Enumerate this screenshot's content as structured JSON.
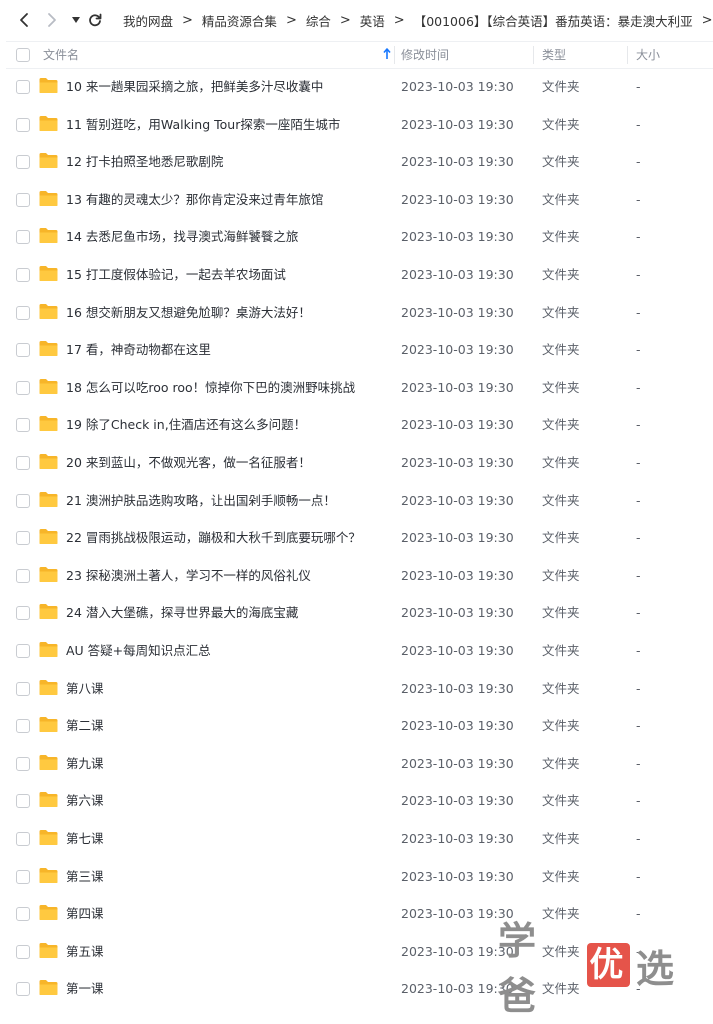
{
  "nav": {
    "back_icon": "chevron-left-icon",
    "forward_icon": "chevron-right-icon",
    "dropdown_icon": "caret-down-icon",
    "refresh_icon": "refresh-icon"
  },
  "breadcrumbs": [
    "我的网盘",
    "精品资源合集",
    "综合",
    "英语",
    "【001006】【综合英语】番茄英语：暴走澳大利亚"
  ],
  "breadcrumb_separator": ">",
  "columns": {
    "name": "文件名",
    "modified": "修改时间",
    "type": "类型",
    "size": "大小"
  },
  "sort": {
    "column": "name",
    "direction": "ascending",
    "icon": "arrow-up-icon"
  },
  "colors": {
    "folder": "#ffc53d",
    "sort_arrow": "#1677ff",
    "watermark_seal": "#e5544a"
  },
  "files": [
    {
      "name": "10 来一趟果园采摘之旅，把鲜美多汁尽收囊中",
      "modified": "2023-10-03 19:30",
      "type": "文件夹",
      "size": "-"
    },
    {
      "name": "11 暂别逛吃，用Walking Tour探索一座陌生城市",
      "modified": "2023-10-03 19:30",
      "type": "文件夹",
      "size": "-"
    },
    {
      "name": "12 打卡拍照圣地悉尼歌剧院",
      "modified": "2023-10-03 19:30",
      "type": "文件夹",
      "size": "-"
    },
    {
      "name": "13 有趣的灵魂太少？那你肯定没来过青年旅馆",
      "modified": "2023-10-03 19:30",
      "type": "文件夹",
      "size": "-"
    },
    {
      "name": "14 去悉尼鱼市场，找寻澳式海鲜饕餮之旅",
      "modified": "2023-10-03 19:30",
      "type": "文件夹",
      "size": "-"
    },
    {
      "name": "15 打工度假体验记，一起去羊农场面试",
      "modified": "2023-10-03 19:30",
      "type": "文件夹",
      "size": "-"
    },
    {
      "name": "16 想交新朋友又想避免尬聊？桌游大法好！",
      "modified": "2023-10-03 19:30",
      "type": "文件夹",
      "size": "-"
    },
    {
      "name": "17 看，神奇动物都在这里",
      "modified": "2023-10-03 19:30",
      "type": "文件夹",
      "size": "-"
    },
    {
      "name": "18 怎么可以吃roo roo！惊掉你下巴的澳洲野味挑战",
      "modified": "2023-10-03 19:30",
      "type": "文件夹",
      "size": "-"
    },
    {
      "name": "19 除了Check in,住酒店还有这么多问题！",
      "modified": "2023-10-03 19:30",
      "type": "文件夹",
      "size": "-"
    },
    {
      "name": "20 来到蓝山，不做观光客，做一名征服者！",
      "modified": "2023-10-03 19:30",
      "type": "文件夹",
      "size": "-"
    },
    {
      "name": "21 澳洲护肤品选购攻略，让出国剁手顺畅一点！",
      "modified": "2023-10-03 19:30",
      "type": "文件夹",
      "size": "-"
    },
    {
      "name": "22 冒雨挑战极限运动，蹦极和大秋千到底要玩哪个？",
      "modified": "2023-10-03 19:30",
      "type": "文件夹",
      "size": "-"
    },
    {
      "name": "23 探秘澳洲土著人，学习不一样的风俗礼仪",
      "modified": "2023-10-03 19:30",
      "type": "文件夹",
      "size": "-"
    },
    {
      "name": "24 潜入大堡礁，探寻世界最大的海底宝藏",
      "modified": "2023-10-03 19:30",
      "type": "文件夹",
      "size": "-"
    },
    {
      "name": "AU 答疑+每周知识点汇总",
      "modified": "2023-10-03 19:30",
      "type": "文件夹",
      "size": "-"
    },
    {
      "name": "第八课",
      "modified": "2023-10-03 19:30",
      "type": "文件夹",
      "size": "-"
    },
    {
      "name": "第二课",
      "modified": "2023-10-03 19:30",
      "type": "文件夹",
      "size": "-"
    },
    {
      "name": "第九课",
      "modified": "2023-10-03 19:30",
      "type": "文件夹",
      "size": "-"
    },
    {
      "name": "第六课",
      "modified": "2023-10-03 19:30",
      "type": "文件夹",
      "size": "-"
    },
    {
      "name": "第七课",
      "modified": "2023-10-03 19:30",
      "type": "文件夹",
      "size": "-"
    },
    {
      "name": "第三课",
      "modified": "2023-10-03 19:30",
      "type": "文件夹",
      "size": "-"
    },
    {
      "name": "第四课",
      "modified": "2023-10-03 19:30",
      "type": "文件夹",
      "size": "-"
    },
    {
      "name": "第五课",
      "modified": "2023-10-03 19:30",
      "type": "文件夹",
      "size": "-"
    },
    {
      "name": "第一课",
      "modified": "2023-10-03 19:30",
      "type": "文件夹",
      "size": "-"
    }
  ],
  "watermark": {
    "left": "学爸",
    "seal": "优",
    "right": "选"
  }
}
